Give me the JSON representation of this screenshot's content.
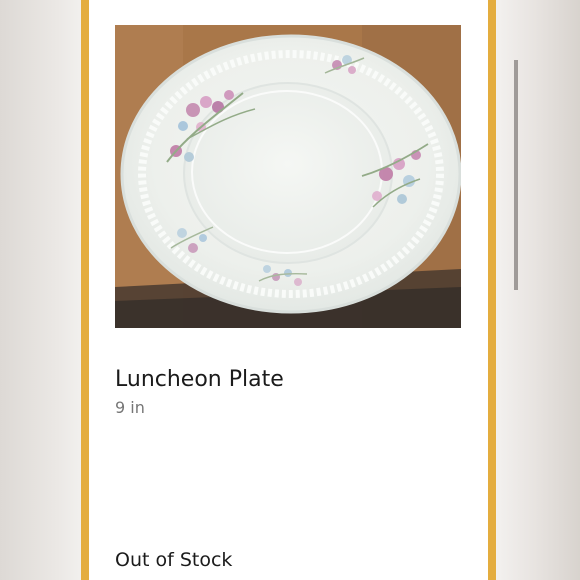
{
  "product": {
    "title": "Luncheon Plate",
    "size": "9 in",
    "stock_status": "Out of Stock",
    "image_alt": "White porcelain plate with pink floral pattern"
  },
  "colors": {
    "frame_accent": "#e4ad3f",
    "card_background": "#ffffff",
    "page_background": "#e9e6e3",
    "title_text": "#1b1b1b",
    "secondary_text": "#767676"
  }
}
